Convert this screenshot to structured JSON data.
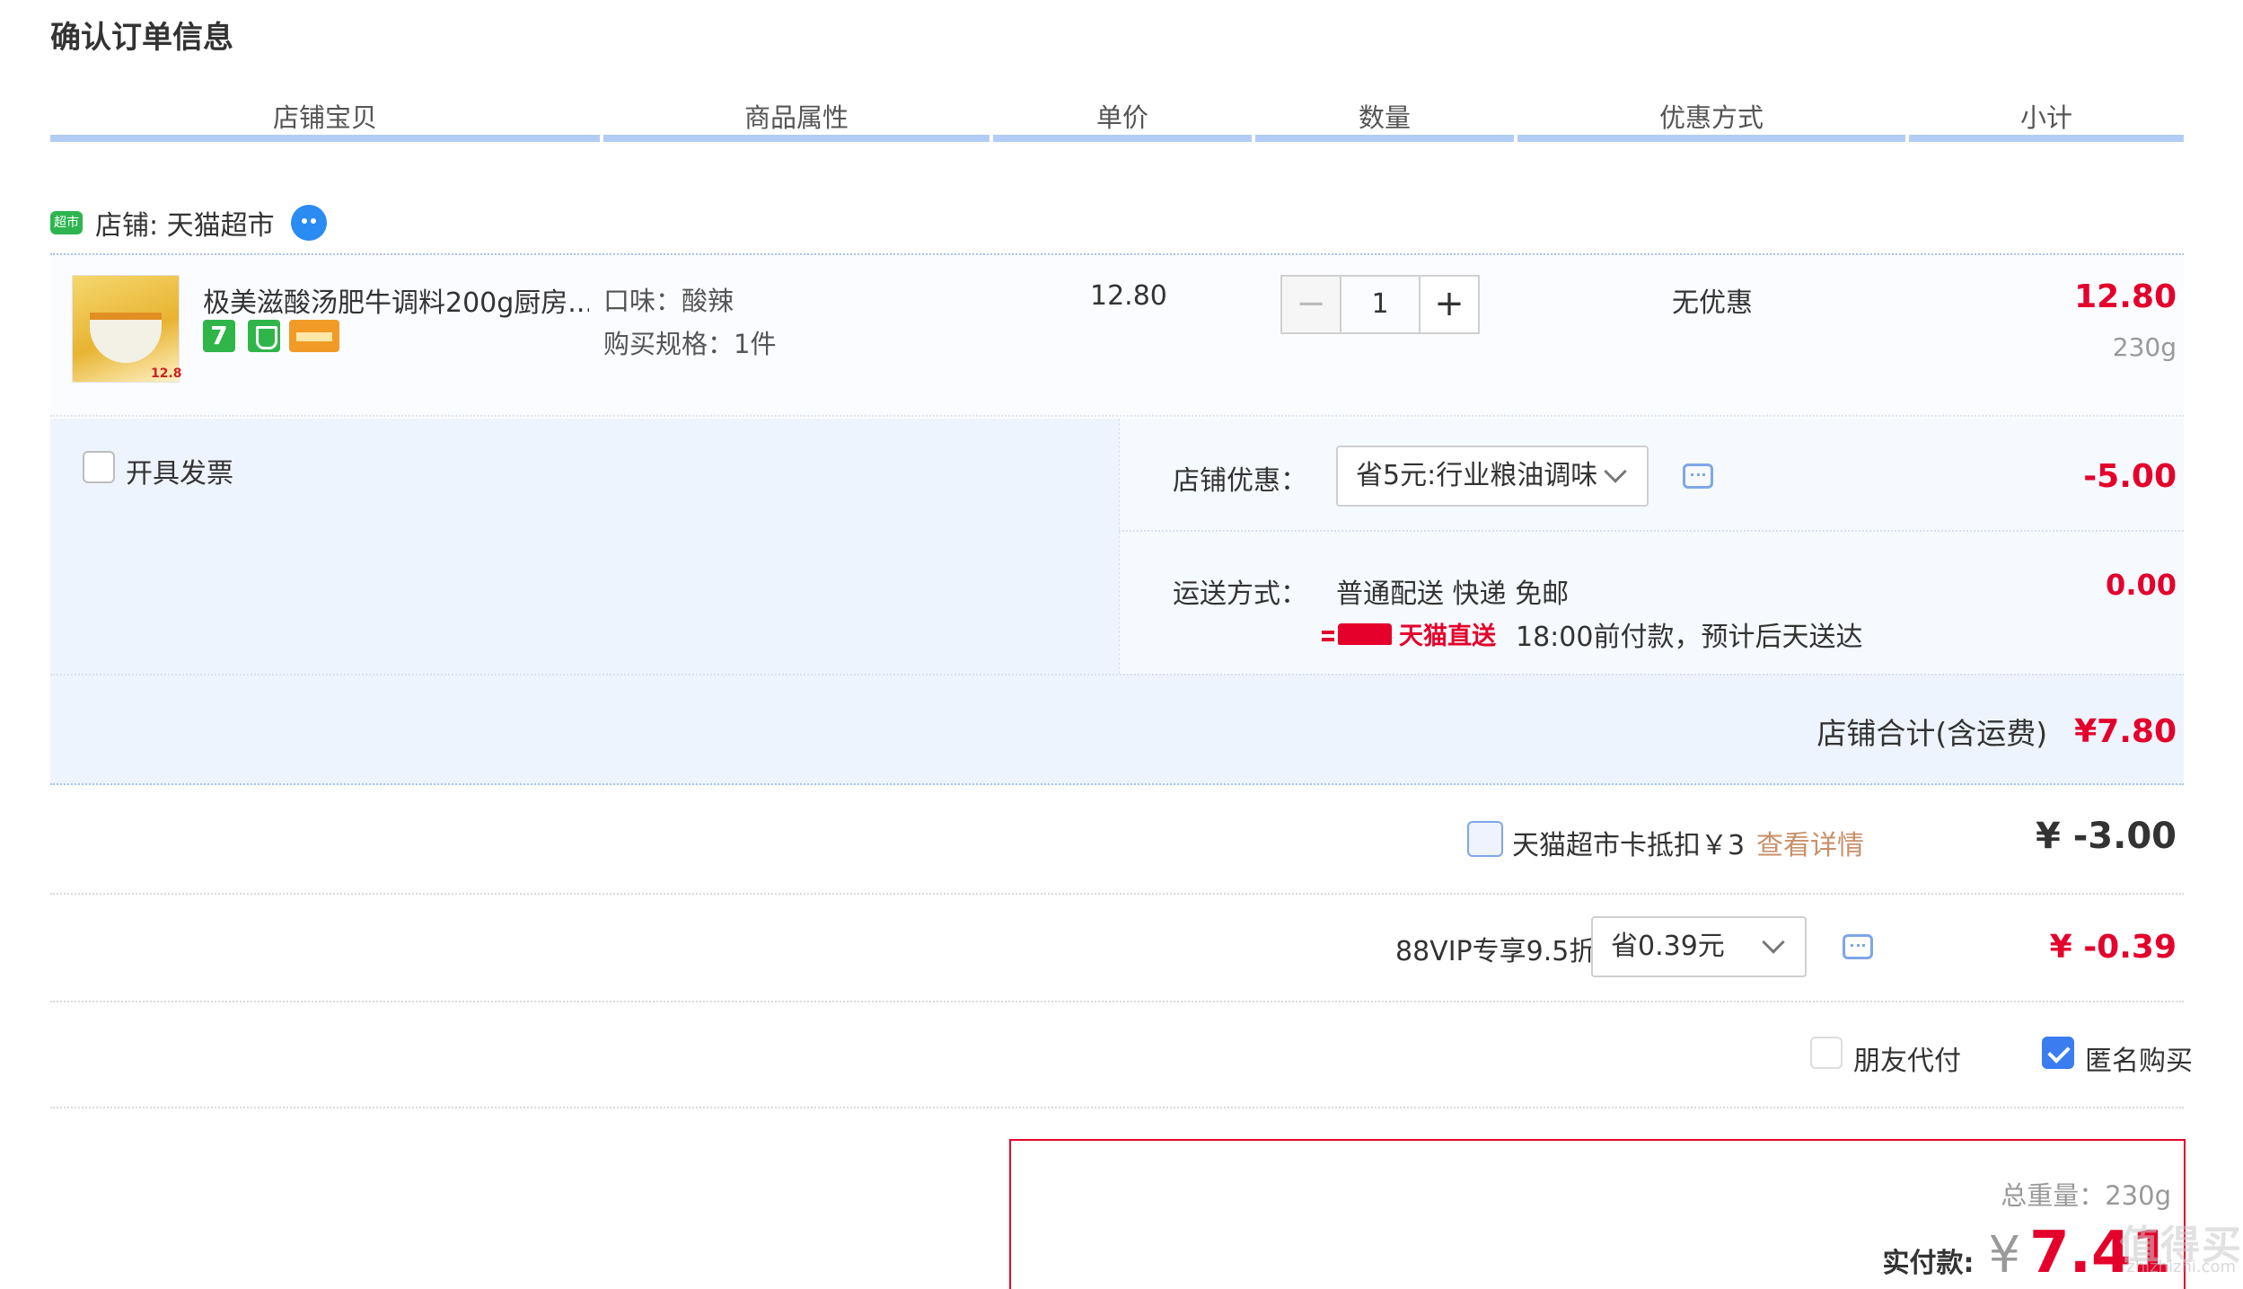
{
  "page_title": "确认订单信息",
  "columns": [
    "店铺宝贝",
    "商品属性",
    "单价",
    "数量",
    "优惠方式",
    "小计"
  ],
  "shop": {
    "icon_text": "超市",
    "label": "店铺: 天猫超市"
  },
  "item": {
    "name": "极美滋酸汤肥牛调料200g厨房...",
    "thumb_price": "12.8",
    "badge_seven": "7",
    "attr_flavor": "口味：酸辣",
    "attr_spec": "购买规格：1件",
    "unit_price": "12.80",
    "qty_minus": "−",
    "qty_value": "1",
    "qty_plus": "+",
    "discount": "无优惠",
    "subtotal": "12.80",
    "weight": "230g"
  },
  "invoice": {
    "label": "开具发票"
  },
  "shop_discount": {
    "label": "店铺优惠：",
    "selected": "省5元:行业粮油调味",
    "amount": "-5.00"
  },
  "shipping": {
    "label": "运送方式：",
    "method": "普通配送 快递 免邮",
    "tmall_direct": "天猫直送",
    "note": "18:00前付款，预计后天送达",
    "amount": "0.00"
  },
  "shop_total": {
    "label": "店铺合计(含运费)",
    "amount": "¥7.80"
  },
  "card_deduct": {
    "label": "天猫超市卡抵扣￥3",
    "link": "查看详情",
    "amount": "¥ -3.00"
  },
  "vip": {
    "label": "88VIP专享9.5折",
    "selected": "省0.39元",
    "amount": "¥ -0.39"
  },
  "options": {
    "friend_pay": "朋友代付",
    "anonymous": "匿名购买"
  },
  "payment": {
    "weight_label": "总重量：230g",
    "pay_label": "实付款:",
    "currency": "¥",
    "amount": "7.41"
  },
  "watermark": {
    "main": "值得买",
    "sub": "zhizhizhi.com"
  },
  "colors": {
    "accent_red": "#e4002b",
    "header_line": "#b2cdf5",
    "check_blue": "#3b7cf0"
  }
}
